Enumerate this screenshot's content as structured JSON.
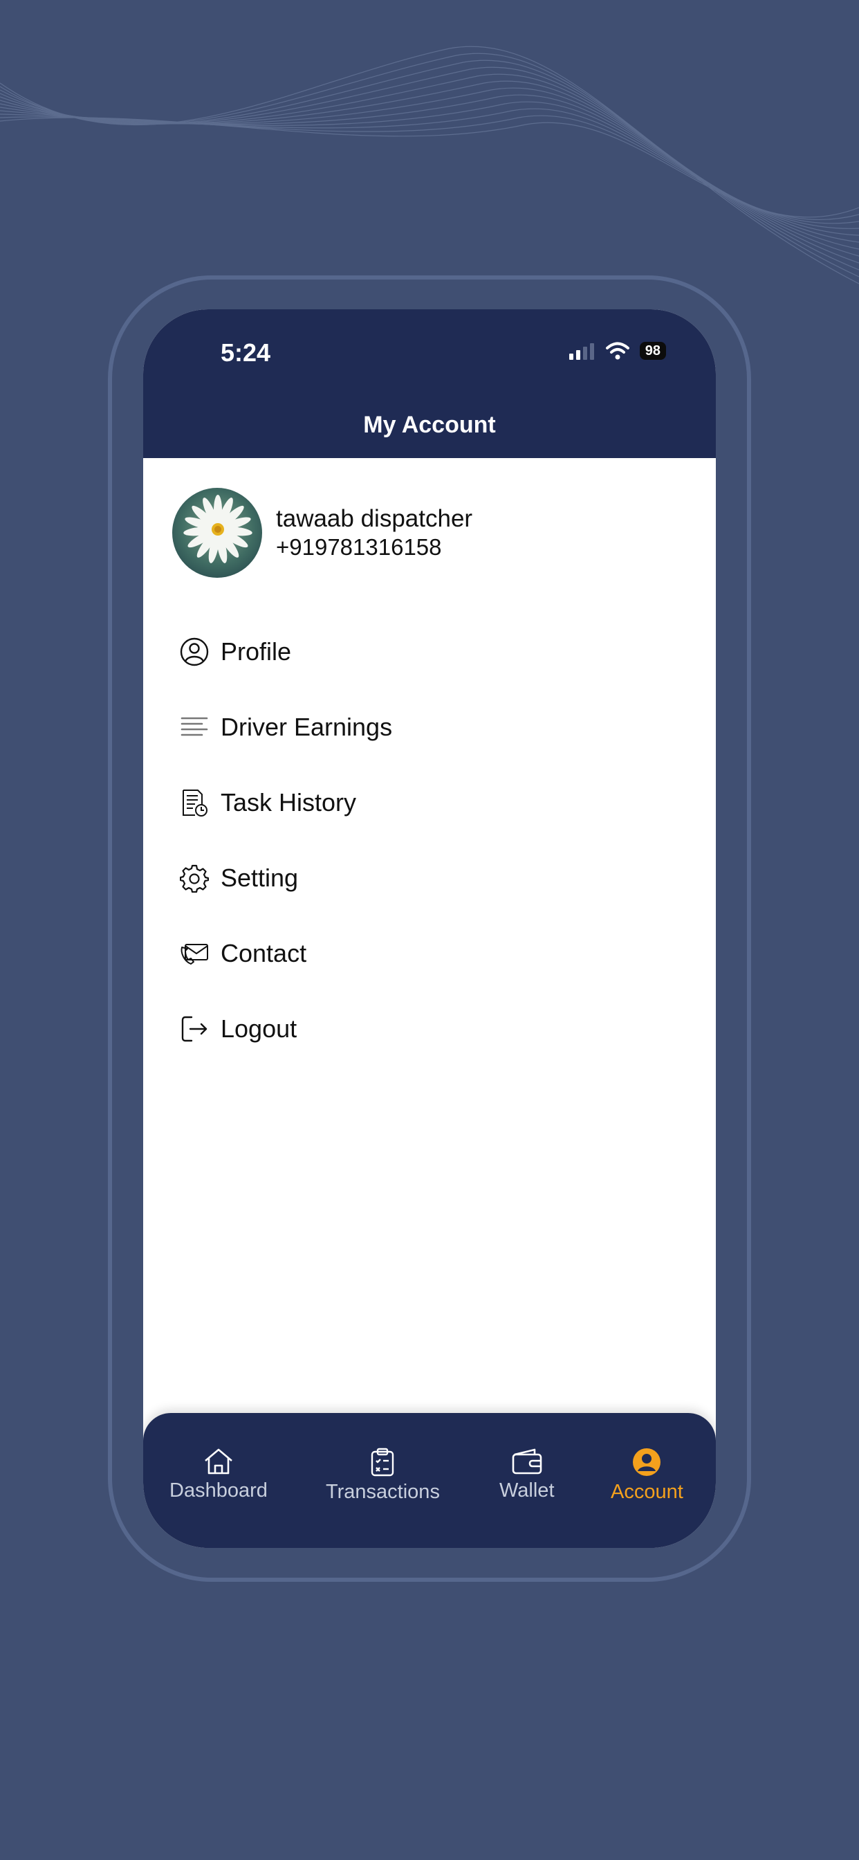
{
  "status_bar": {
    "time": "5:24",
    "battery": "98"
  },
  "header": {
    "title": "My Account"
  },
  "user": {
    "name": "tawaab dispatcher",
    "phone": "+919781316158"
  },
  "menu": {
    "items": [
      {
        "label": "Profile",
        "icon": "user-circle-icon"
      },
      {
        "label": "Driver Earnings",
        "icon": "lines-icon"
      },
      {
        "label": "Task History",
        "icon": "document-clock-icon"
      },
      {
        "label": "Setting",
        "icon": "gear-icon"
      },
      {
        "label": "Contact",
        "icon": "envelope-phone-icon"
      },
      {
        "label": "Logout",
        "icon": "logout-icon"
      }
    ]
  },
  "bottom_nav": {
    "items": [
      {
        "label": "Dashboard",
        "icon": "home-icon"
      },
      {
        "label": "Transactions",
        "icon": "clipboard-icon"
      },
      {
        "label": "Wallet",
        "icon": "wallet-icon"
      },
      {
        "label": "Account",
        "icon": "account-icon"
      }
    ],
    "active": "Account"
  },
  "colors": {
    "background": "#404f72",
    "header": "#1f2b54",
    "accent": "#f4a11d"
  }
}
